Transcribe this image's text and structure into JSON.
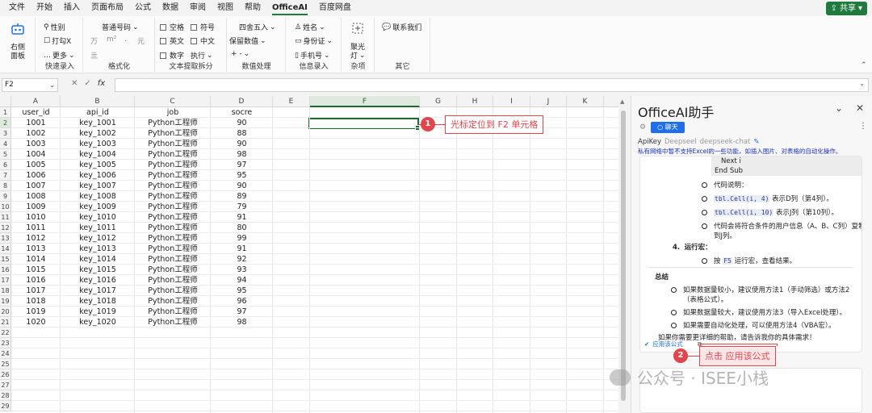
{
  "menu": {
    "items": [
      "文件",
      "开始",
      "插入",
      "页面布局",
      "公式",
      "数据",
      "审阅",
      "视图",
      "帮助",
      "OfficeAI",
      "百度网盘"
    ],
    "active_index": 9,
    "share_label": "共享"
  },
  "ribbon": {
    "panel_button": {
      "line1": "右侧",
      "line2": "面板"
    },
    "quick_entry": {
      "gender": "性别",
      "checkx": "打勾X",
      "more": "更多",
      "label": "快速录入"
    },
    "format": {
      "normal_number": "普通号码",
      "wan": "万",
      "m2": "m²",
      "dot": ".",
      "yuan": "元",
      "lamp": "亖",
      "label": "格式化"
    },
    "text_extract": {
      "space": "空格",
      "symbol": "符号",
      "english": "英文",
      "chinese": "中文",
      "digit": "数字",
      "execute": "执行",
      "label": "文本提取拆分"
    },
    "number_proc": {
      "rounding": "四舍五入",
      "keep_decimal": "保留数值",
      "plusminus": "+ -",
      "label": "数值处理"
    },
    "info_entry": {
      "name": "姓名",
      "id_card": "身份证",
      "phone": "手机号",
      "label": "信息录入"
    },
    "misc": {
      "spotlight_line1": "聚光",
      "spotlight_line2": "灯",
      "label": "杂项"
    },
    "other": {
      "contact": "联系我们",
      "label": "其它"
    }
  },
  "formula_bar": {
    "name_box": "F2",
    "fx": "fx",
    "value": ""
  },
  "sheet": {
    "columns": [
      "A",
      "B",
      "C",
      "D",
      "E",
      "F",
      "G",
      "H",
      "I",
      "J",
      "K"
    ],
    "selected_column": "F",
    "selected_row": 2,
    "row_numbers": [
      1,
      2,
      3,
      4,
      5,
      6,
      7,
      8,
      9,
      10,
      11,
      12,
      13,
      14,
      15,
      16,
      17,
      18,
      19,
      20,
      21,
      22,
      23,
      24,
      25,
      26,
      27,
      28,
      29
    ],
    "headers": [
      "user_id",
      "api_id",
      "job",
      "socre"
    ],
    "rows": [
      [
        "1001",
        "key_1001",
        "Python工程师",
        "90"
      ],
      [
        "1002",
        "key_1002",
        "Python工程师",
        "88"
      ],
      [
        "1003",
        "key_1003",
        "Python工程师",
        "90"
      ],
      [
        "1004",
        "key_1004",
        "Python工程师",
        "98"
      ],
      [
        "1005",
        "key_1005",
        "Python工程师",
        "97"
      ],
      [
        "1006",
        "key_1006",
        "Python工程师",
        "95"
      ],
      [
        "1007",
        "key_1007",
        "Python工程师",
        "90"
      ],
      [
        "1008",
        "key_1008",
        "Python工程师",
        "89"
      ],
      [
        "1009",
        "key_1009",
        "Python工程师",
        "79"
      ],
      [
        "1010",
        "key_1010",
        "Python工程师",
        "91"
      ],
      [
        "1011",
        "key_1011",
        "Python工程师",
        "80"
      ],
      [
        "1012",
        "key_1012",
        "Python工程师",
        "99"
      ],
      [
        "1013",
        "key_1013",
        "Python工程师",
        "91"
      ],
      [
        "1014",
        "key_1014",
        "Python工程师",
        "92"
      ],
      [
        "1015",
        "key_1015",
        "Python工程师",
        "93"
      ],
      [
        "1016",
        "key_1016",
        "Python工程师",
        "94"
      ],
      [
        "1017",
        "key_1017",
        "Python工程师",
        "95"
      ],
      [
        "1018",
        "key_1018",
        "Python工程师",
        "96"
      ],
      [
        "1019",
        "key_1019",
        "Python工程师",
        "97"
      ],
      [
        "1020",
        "key_1020",
        "Python工程师",
        "98"
      ]
    ]
  },
  "annotations": {
    "one": {
      "num": "1",
      "text": "光标定位到 F2 单元格"
    },
    "two": {
      "num": "2",
      "text": "点击 应用该公式"
    }
  },
  "panel": {
    "title": "OfficeAI助手",
    "chat_label": "聊天",
    "tabs": {
      "apikey": "ApiKey",
      "deepseek": "Deepseel",
      "model": "deepseek-chat"
    },
    "warning": "私有网络中暂不支持Excel的一些功能，如插入图片、对表格的自动化操作。",
    "code_line1": "Next i",
    "code_line2": "End Sub",
    "code_explain": "代码说明：",
    "b1_code": "tbl.Cell(i, 4)",
    "b1_text": "表示D列（第4列）。",
    "b2_code": "tbl.Cell(i, 10)",
    "b2_text": "表示J列（第10列）。",
    "b3_line1": "代码会将符合条件的用户信息（A、B、C列）复制",
    "b3_line2": "到J列。",
    "step4_num": "4.",
    "step4_title": "运行宏：",
    "step4_pre": "按",
    "step4_key": "F5",
    "step4_post": "运行宏，查看结果。",
    "summary_title": "总结",
    "s1_line1": "如果数据量较小，建议使用方法1（手动筛选）或方法2",
    "s1_line2": "（表格公式）。",
    "s2": "如果数据量较大，建议使用方法3（导入Excel处理）。",
    "s3": "如果需要自动化处理，可以使用方法4（VBA宏）。",
    "closing": "如果你需要更详细的帮助，请告诉我你的具体需求！",
    "apply_label": "应用该公式"
  },
  "watermark": "公众号 · ISEE小栈",
  "colors": {
    "accent_green": "#1d6b33",
    "annotation_red": "#e0464c",
    "chat_blue": "#1f6feb"
  }
}
